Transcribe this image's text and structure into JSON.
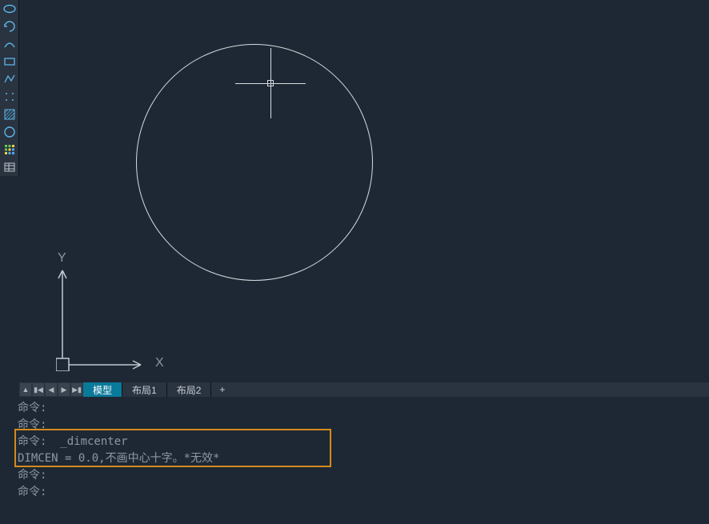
{
  "toolbar": {
    "items": [
      {
        "name": "ellipse-icon"
      },
      {
        "name": "rotate-icon"
      },
      {
        "name": "arc-icon"
      },
      {
        "name": "rectangle-icon"
      },
      {
        "name": "polyline-icon"
      },
      {
        "name": "dots-icon"
      },
      {
        "name": "hatch-icon"
      },
      {
        "name": "circle-icon"
      },
      {
        "name": "grid-icon"
      },
      {
        "name": "table-icon"
      }
    ]
  },
  "tabs": {
    "model": "模型",
    "layout1": "布局1",
    "layout2": "布局2",
    "add": "+"
  },
  "ucs": {
    "x_label": "X",
    "y_label": "Y"
  },
  "command": {
    "prefix": "命令:",
    "lines": [
      "命令:",
      "命令:",
      "命令:  _dimcenter",
      "DIMCEN = 0.0,不画中心十字。*无效*",
      "命令:",
      "命令:"
    ]
  }
}
